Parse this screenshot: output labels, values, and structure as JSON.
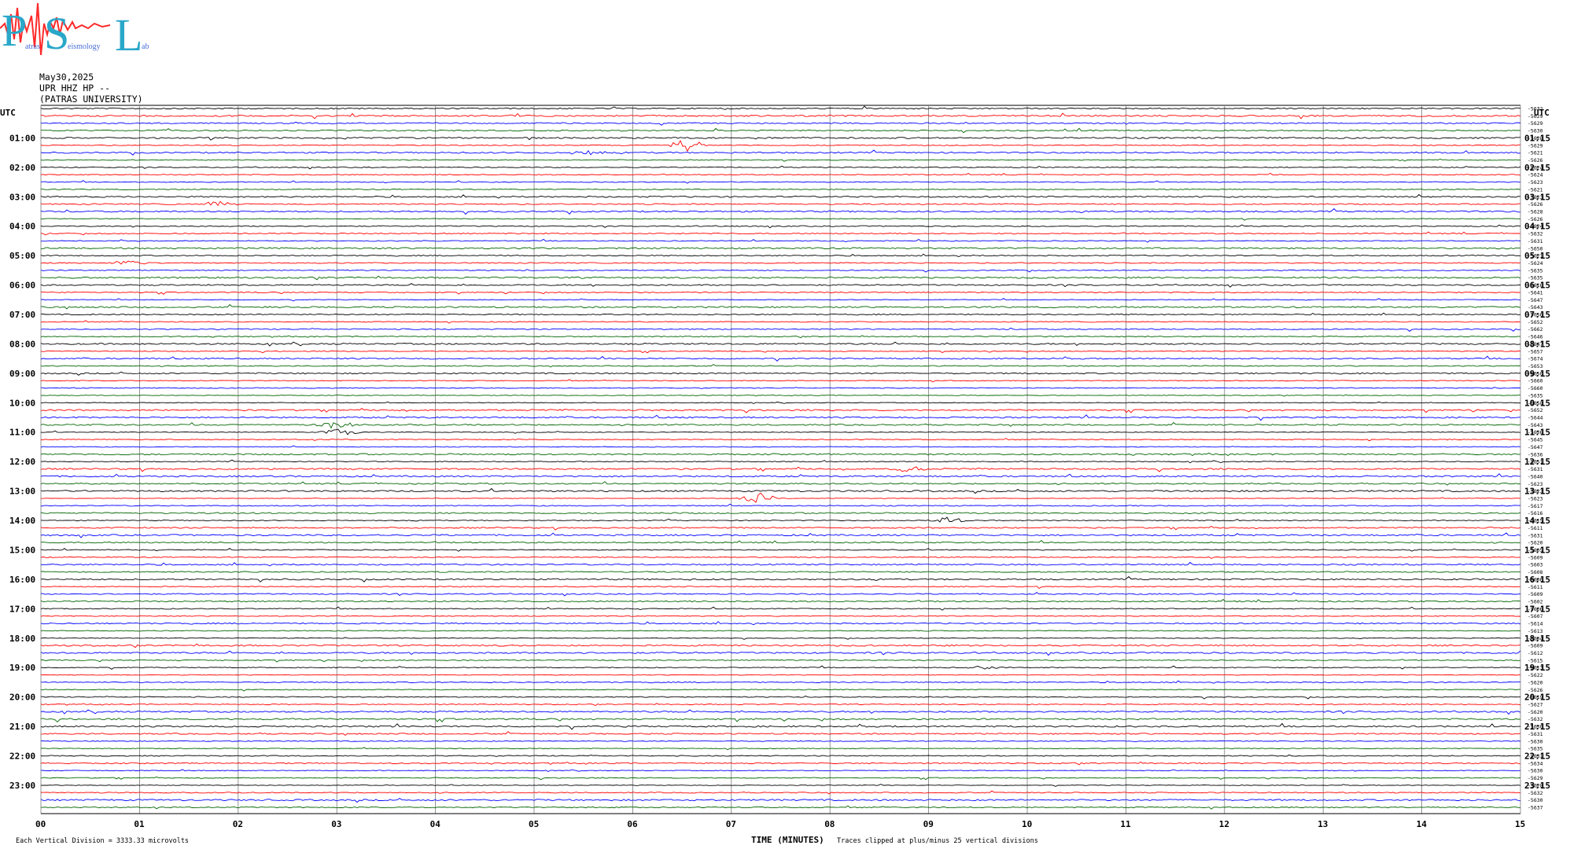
{
  "logo": {
    "letters": [
      "P",
      "S",
      "L"
    ],
    "words": [
      "atras",
      "eismology",
      "ab"
    ],
    "colors": {
      "letters": "#2aa7c9",
      "wave": "#ff2a2a",
      "words": "#4a6fd8"
    }
  },
  "header": {
    "date": "May30,2025",
    "station": "UPR HHZ HP --",
    "institution": "(PATRAS UNIVERSITY)"
  },
  "chart_data": {
    "type": "line",
    "title": "",
    "left_axis_label": "UTC",
    "right_axis_label": "UTC",
    "xlabel": "TIME (MINUTES)",
    "xlim": [
      0,
      15
    ],
    "x_ticks": [
      "00",
      "01",
      "02",
      "03",
      "04",
      "05",
      "06",
      "07",
      "08",
      "09",
      "10",
      "11",
      "12",
      "13",
      "14",
      "15"
    ],
    "trace_colors": [
      "#000000",
      "#ff0000",
      "#0000ff",
      "#006400"
    ],
    "left_hour_labels": [
      "01:00",
      "02:00",
      "03:00",
      "04:00",
      "05:00",
      "06:00",
      "07:00",
      "08:00",
      "09:00",
      "10:00",
      "11:00",
      "12:00",
      "13:00",
      "14:00",
      "15:00",
      "16:00",
      "17:00",
      "18:00",
      "19:00",
      "20:00",
      "21:00",
      "22:00",
      "23:00"
    ],
    "right_hour_labels": [
      "01:15",
      "02:15",
      "03:15",
      "04:15",
      "05:15",
      "06:15",
      "07:15",
      "08:15",
      "09:15",
      "10:15",
      "11:15",
      "12:15",
      "13:15",
      "14:15",
      "15:15",
      "16:15",
      "17:15",
      "18:15",
      "19:15",
      "20:15",
      "21:15",
      "22:15",
      "23:15"
    ],
    "trace_offsets": [
      "-5632",
      "-5629",
      "-5629",
      "-5630",
      "-5628",
      "-5629",
      "-5621",
      "-5626",
      "-5624",
      "-5624",
      "-5623",
      "-5621",
      "-5623",
      "-5626",
      "-5628",
      "-5626",
      "-5624",
      "-5632",
      "-5631",
      "-5650",
      "-5621",
      "-5624",
      "-5635",
      "-5635",
      "-5616",
      "-5641",
      "-5647",
      "-5643",
      "-5656",
      "-5652",
      "-5662",
      "-5646",
      "-5647",
      "-5657",
      "-5674",
      "-5653",
      "-5650",
      "-5660",
      "-5660",
      "-5635",
      "-5658",
      "-5652",
      "-5644",
      "-5643",
      "-5636",
      "-5645",
      "-5647",
      "-5636",
      "-5651",
      "-5631",
      "-5640",
      "-5623",
      "-5623",
      "-5623",
      "-5617",
      "-5616",
      "-5615",
      "-5611",
      "-5631",
      "-5620",
      "-5605",
      "-5609",
      "-5603",
      "-5608",
      "-5606",
      "-5611",
      "-5609",
      "-5602",
      "-5606",
      "-5607",
      "-5614",
      "-5613",
      "-5604",
      "-5609",
      "-5612",
      "-5615",
      "-5613",
      "-5622",
      "-5620",
      "-5626",
      "-5619",
      "-5627",
      "-5620",
      "-5632",
      "-5630",
      "-5631",
      "-5630",
      "-5635",
      "-5631",
      "-5634",
      "-5630",
      "-5629",
      "-5628",
      "-5632",
      "-5630",
      "-5637"
    ],
    "events": [
      {
        "trace": 5,
        "minute": 6.55,
        "amplitude": 8
      },
      {
        "trace": 6,
        "minute": 5.55,
        "amplitude": 4
      },
      {
        "trace": 13,
        "minute": 1.8,
        "amplitude": 4
      },
      {
        "trace": 21,
        "minute": 0.9,
        "amplitude": 4
      },
      {
        "trace": 43,
        "minute": 3.0,
        "amplitude": 5
      },
      {
        "trace": 44,
        "minute": 3.05,
        "amplitude": 5
      },
      {
        "trace": 49,
        "minute": 8.8,
        "amplitude": 4
      },
      {
        "trace": 53,
        "minute": 7.25,
        "amplitude": 9
      },
      {
        "trace": 56,
        "minute": 9.2,
        "amplitude": 4
      },
      {
        "trace": 76,
        "minute": 9.6,
        "amplitude": 3
      }
    ],
    "footer_left": "Each Vertical Division = 3333.33 microvolts",
    "footer_right": "Traces clipped at plus/minus 25 vertical divisions"
  }
}
